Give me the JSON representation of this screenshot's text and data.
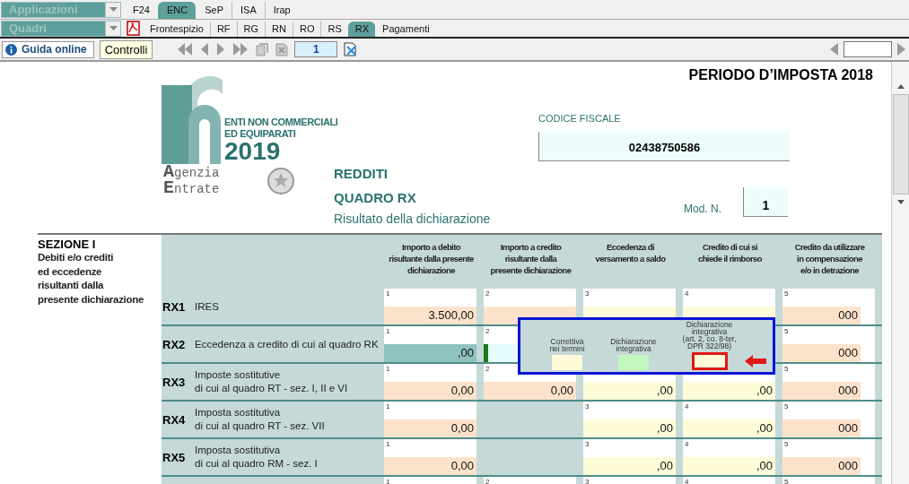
{
  "app_bar": {
    "dropdown": "Applicazioni",
    "tabs": [
      {
        "label": "F24",
        "selected": false
      },
      {
        "label": "ENC",
        "selected": true
      },
      {
        "label": "SeP",
        "selected": false
      },
      {
        "label": "ISA",
        "selected": false
      },
      {
        "label": "Irap",
        "selected": false
      }
    ]
  },
  "section_bar": {
    "dropdown": "Quadri",
    "tabs": [
      {
        "label": "Frontespizio",
        "selected": false
      },
      {
        "label": "RF",
        "selected": false
      },
      {
        "label": "RG",
        "selected": false
      },
      {
        "label": "RN",
        "selected": false
      },
      {
        "label": "RO",
        "selected": false
      },
      {
        "label": "RS",
        "selected": false
      },
      {
        "label": "RX",
        "selected": true
      },
      {
        "label": "Pagamenti",
        "selected": false
      }
    ]
  },
  "toolbar": {
    "help_button": "Guida online",
    "checks_button": "Controlli",
    "page": "1"
  },
  "form": {
    "period": "PERIODO D’IMPOSTA 2018",
    "logo": {
      "line_1": "ENTI NON COMMERCIALI",
      "line_2": "ED EQUIPARATI",
      "year": "2019",
      "agency_1": "Agenzia",
      "agency_2": "Entrate"
    },
    "titles": [
      "REDDITI",
      "QUADRO RX"
    ],
    "subtitle": "Risultato della dichiarazione",
    "tax_code_label": "CODICE FISCALE",
    "tax_code": "02438750586",
    "model_label": "Mod. N.",
    "model": "1",
    "section_title": "SEZIONE I",
    "section_text": "Debiti e/o crediti\ned eccedenze\nrisultanti dalla\npresente dichiarazione",
    "columns": [
      "Importo a debito\nrisultante dalla presente\ndichiarazione",
      "Importo a credito\nrisultante dalla\npresente dichiarazione",
      "Eccedenza di\nversamento a saldo",
      "Credito di cui si\nchiede il rimborso",
      "Credito da utilizzare\nin compensazione\ne/o in detrazione"
    ],
    "rows": [
      {
        "code": "RX1",
        "label": "IRES",
        "cells": [
          {
            "num": "1",
            "kind": "debit",
            "value": "3.500,00"
          },
          {
            "num": "2",
            "kind": "debit"
          },
          {
            "num": "3",
            "kind": "credit"
          },
          {
            "num": "4",
            "kind": "credit"
          },
          {
            "num": "5",
            "kind": "debit",
            "value": "000"
          }
        ]
      },
      {
        "code": "RX2",
        "label": "Eccedenza a credito di cui al quadro RK",
        "cells": [
          {
            "num": "1",
            "kind": "teal",
            "value": ",00"
          },
          {
            "num": "2",
            "kind": "cyan"
          },
          {
            "kind": "none"
          },
          {
            "kind": "none"
          },
          {
            "num": "5",
            "kind": "debit",
            "value": "000"
          }
        ]
      },
      {
        "code": "RX3",
        "label": "Imposte sostitutive\ndi cui al quadro RT - sez. I, II e VI",
        "cells": [
          {
            "num": "1",
            "kind": "debit",
            "value": "0,00"
          },
          {
            "num": "2",
            "kind": "debit",
            "value": "0,00"
          },
          {
            "kind": "credit",
            "value": ",00"
          },
          {
            "kind": "credit",
            "value": ",00"
          },
          {
            "num": "5",
            "kind": "debit",
            "value": "000"
          }
        ]
      },
      {
        "code": "RX4",
        "label": "Imposta sostitutiva\ndi cui al quadro RT - sez. VII",
        "cells": [
          {
            "num": "1",
            "kind": "debit",
            "value": "0,00"
          },
          {
            "kind": "none"
          },
          {
            "num": "3",
            "kind": "credit",
            "value": ",00"
          },
          {
            "num": "4",
            "kind": "credit",
            "value": ",00"
          },
          {
            "num": "5",
            "kind": "debit",
            "value": "000"
          }
        ]
      },
      {
        "code": "RX5",
        "label": "Imposta sostitutiva\ndi cui al quadro RM - sez. I",
        "cells": [
          {
            "num": "1",
            "kind": "debit",
            "value": "0,00"
          },
          {
            "kind": "none"
          },
          {
            "num": "3",
            "kind": "credit",
            "value": ",00"
          },
          {
            "num": "4",
            "kind": "credit",
            "value": ",00"
          },
          {
            "num": "5",
            "kind": "debit",
            "value": "000"
          }
        ]
      },
      {
        "cells": [
          {
            "num": "1",
            "kind": "blank"
          },
          {
            "num": "2",
            "kind": "blank"
          },
          {
            "num": "3",
            "kind": "blank"
          },
          {
            "num": "4",
            "kind": "blank"
          },
          {
            "num": "5",
            "kind": "blank"
          }
        ]
      }
    ],
    "popup": {
      "fields": [
        {
          "label": "Correttiva\nnei termini",
          "checked": false,
          "highlighted": false
        },
        {
          "label": "Dichiarazione\nintegrativa",
          "checked": true,
          "highlighted": false
        },
        {
          "label": "Dichiarazione\nintegrativa\n(art. 2, co. 8-ter,\nDPR 322/98)",
          "checked": false,
          "highlighted": true
        }
      ]
    }
  }
}
